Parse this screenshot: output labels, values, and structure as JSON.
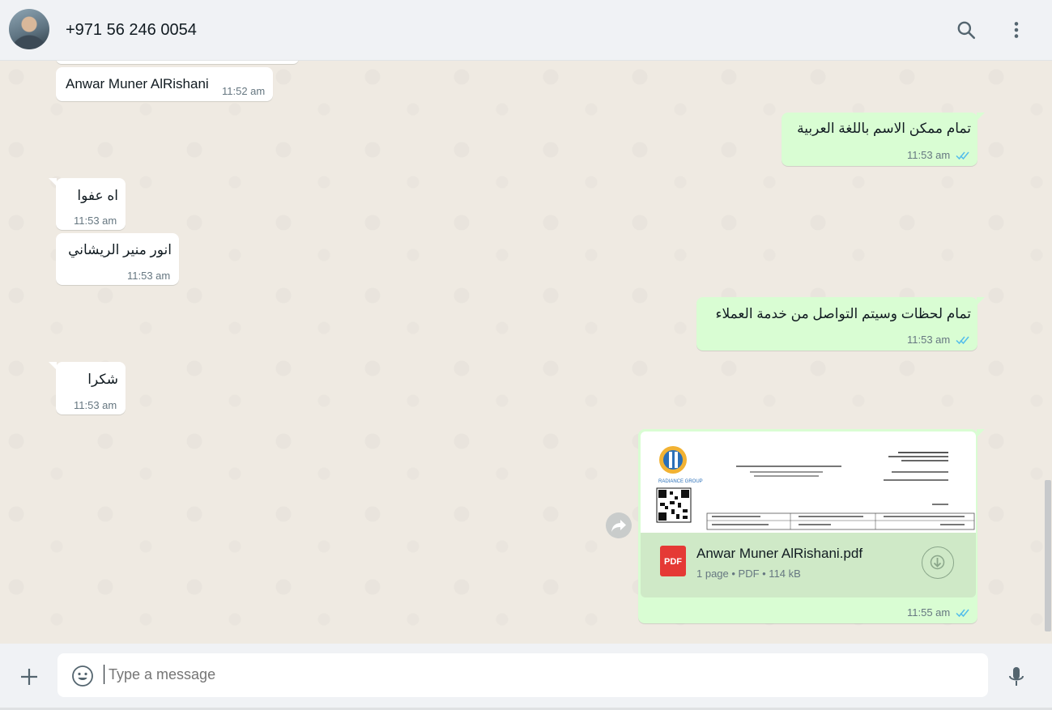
{
  "header": {
    "contact_name": "+971 56 246 0054",
    "icons": [
      "search-icon",
      "menu-icon"
    ]
  },
  "messages": [
    {
      "direction": "in",
      "text": "Anwar Muner AlRishani",
      "time": "11:52 am"
    },
    {
      "direction": "out",
      "text": "تمام ممكن الاسم باللغة العربية",
      "time": "11:53 am",
      "status": "read"
    },
    {
      "direction": "in",
      "text": "اه عفوا",
      "time": "11:53 am"
    },
    {
      "direction": "in",
      "text": "انور منير الريشاني",
      "time": "11:53 am"
    },
    {
      "direction": "out",
      "text": "تمام لحظات وسيتم التواصل من خدمة العملاء",
      "time": "11:53 am",
      "status": "read"
    },
    {
      "direction": "in",
      "text": "شكرا",
      "time": "11:53 am"
    },
    {
      "direction": "out",
      "type": "document",
      "file_name": "Anwar Muner AlRishani.pdf",
      "file_type_badge": "PDF",
      "meta": "1 page • PDF • 114 kB",
      "time": "11:55 am",
      "status": "read",
      "preview": {
        "logo_text": "RADIANCE GROUP",
        "lines": [
          "شركة راديانس للتجارة",
          "الرقم الضريبي : 273 663 523",
          "فاتورة ضريبية 2023 02 29"
        ]
      }
    }
  ],
  "composer": {
    "placeholder": "Type a message",
    "icons": [
      "plus-icon",
      "emoji-icon",
      "mic-icon"
    ]
  },
  "colors": {
    "chat_background": "#efeae2",
    "incoming_bubble": "#ffffff",
    "outgoing_bubble": "#d9fdd3",
    "read_tick": "#53bdeb"
  }
}
